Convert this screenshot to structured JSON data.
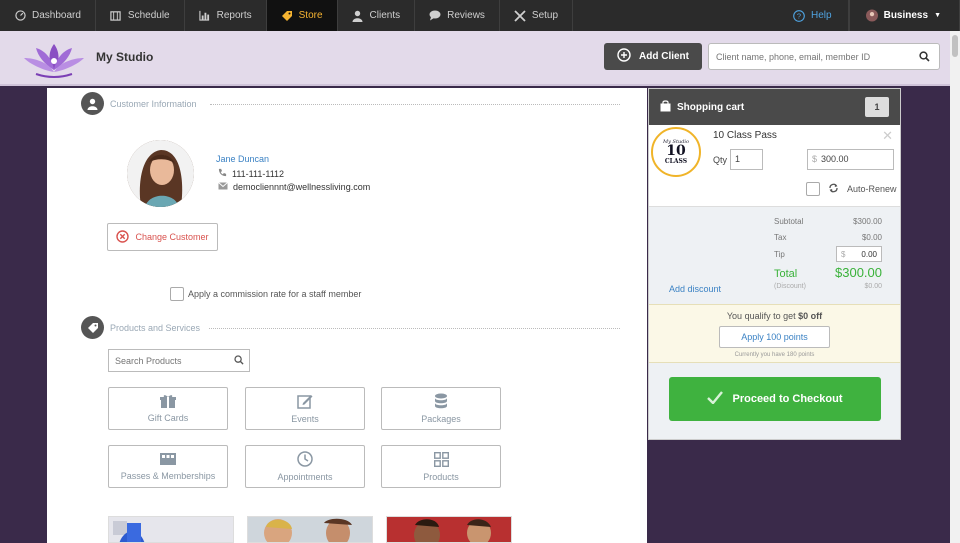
{
  "nav": {
    "items": [
      {
        "label": "Dashboard",
        "icon": "dashboard-icon"
      },
      {
        "label": "Schedule",
        "icon": "calendar-icon"
      },
      {
        "label": "Reports",
        "icon": "bar-chart-icon"
      },
      {
        "label": "Store",
        "icon": "tag-icon"
      },
      {
        "label": "Clients",
        "icon": "user-icon"
      },
      {
        "label": "Reviews",
        "icon": "chat-icon"
      },
      {
        "label": "Setup",
        "icon": "tools-icon"
      }
    ],
    "active_index": 3,
    "help_label": "Help",
    "business_label": "Business"
  },
  "header": {
    "studio_name": "My Studio",
    "add_client_label": "Add Client",
    "search_placeholder": "Client name, phone, email, member ID"
  },
  "customer": {
    "section_label": "Customer Information",
    "name": "Jane Duncan",
    "phone": "111-111-1112",
    "email": "democliennnt@wellnessliving.com",
    "change_label": "Change Customer",
    "commission_label": "Apply a commission rate for a staff member"
  },
  "products": {
    "section_label": "Products and Services",
    "search_placeholder": "Search Products",
    "tiles": [
      {
        "label": "Gift Cards",
        "icon": "gift-icon"
      },
      {
        "label": "Events",
        "icon": "edit-icon"
      },
      {
        "label": "Packages",
        "icon": "database-icon"
      },
      {
        "label": "Passes & Memberships",
        "icon": "ticket-icon"
      },
      {
        "label": "Appointments",
        "icon": "clock-icon"
      },
      {
        "label": "Products",
        "icon": "grid-icon"
      }
    ]
  },
  "cart": {
    "title": "Shopping cart",
    "count": "1",
    "item": {
      "name": "10 Class Pass",
      "badge_line1": "My Studio",
      "badge_line2": "10",
      "badge_line3": "CLASS",
      "qty_label": "Qty",
      "qty": "1",
      "currency": "$",
      "price": "300.00",
      "auto_renew_label": "Auto-Renew"
    },
    "totals": {
      "subtotal_label": "Subtotal",
      "subtotal": "$300.00",
      "tax_label": "Tax",
      "tax": "$0.00",
      "tip_label": "Tip",
      "tip_currency": "$",
      "tip": "0.00",
      "total_label": "Total",
      "total": "$300.00",
      "discount_label": "Discount",
      "discount": "$0.00",
      "add_discount_label": "Add discount"
    },
    "points": {
      "qualify_prefix": "You qualify to get ",
      "qualify_amount": "$0 off",
      "apply_label": "Apply 100 points",
      "current_label": "Currently you have 180 points"
    },
    "checkout_label": "Proceed to Checkout"
  },
  "colors": {
    "nav_bg": "#2b2b2b",
    "active_tab": "#f6b431",
    "header_bg": "#e3daea",
    "checkout_green": "#3fb23f",
    "link_blue": "#3b82c4",
    "danger_red": "#d9534f"
  }
}
